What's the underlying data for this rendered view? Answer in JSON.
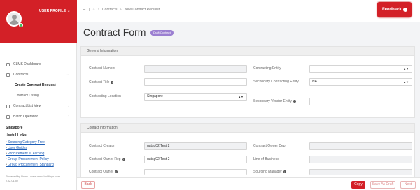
{
  "sidebar": {
    "user_profile": "USER PROFILE",
    "nav": [
      {
        "label": "CLMS Dashboard",
        "icon": "dashboard-icon"
      },
      {
        "label": "Contracts",
        "icon": "contracts-icon"
      }
    ],
    "contracts_sub": [
      "Create Contract Request",
      "Contract Listing"
    ],
    "nav_more": [
      {
        "label": "Contract List View",
        "icon": "list-icon"
      },
      {
        "label": "Batch Operation",
        "icon": "batch-icon"
      }
    ],
    "country": "Singapore",
    "useful_links_title": "Useful Links",
    "links": [
      "Sourcing/Category Tree",
      "User Guides",
      "Procurement eLearning",
      "Group Procurement Policy",
      "Group Procurement Standard"
    ],
    "powered_by": "Powered by Dnsu - www.dnsu.holdings.com",
    "version": "v.02.01.07"
  },
  "topbar": {
    "breadcrumb": [
      "Contracts",
      "New Contract Request"
    ],
    "feedback": "Feedback"
  },
  "page": {
    "title": "Contract Form",
    "badge": "Draft Contract"
  },
  "general": {
    "header": "General Information",
    "contract_number_label": "Contract Number",
    "contract_number": "",
    "contract_title_label": "Contract Title",
    "contract_title": "",
    "contracting_location_label": "Contracting Location",
    "contracting_location": "Singapore",
    "contracting_entity_label": "Contracting Entity",
    "contracting_entity": "",
    "secondary_entity_label": "Secondary Contracting Entity",
    "secondary_entity": "NA",
    "secondary_vendor_label": "Secondary Vendor Entity",
    "secondary_vendor": ""
  },
  "contact": {
    "header": "Contact Information",
    "creator_label": "Contract Creator",
    "creator": "uatsg02 Test 2",
    "owner_dept_label": "Contract Owner Dept",
    "owner_dept": "",
    "owner_rep_label": "Contract Owner Rep",
    "owner_rep": "uatsg02 Test 2",
    "line_of_business_label": "Line of Business",
    "line_of_business": "",
    "owner_label": "Contract Owner",
    "sourcing_manager_label": "Sourcing Manager"
  },
  "footer": {
    "back": "Back",
    "copy": "Copy",
    "save_draft": "Save As Draft",
    "next": "Next"
  },
  "colors": {
    "brand_red": "#d32027",
    "badge_purple": "#9b7fd1"
  }
}
